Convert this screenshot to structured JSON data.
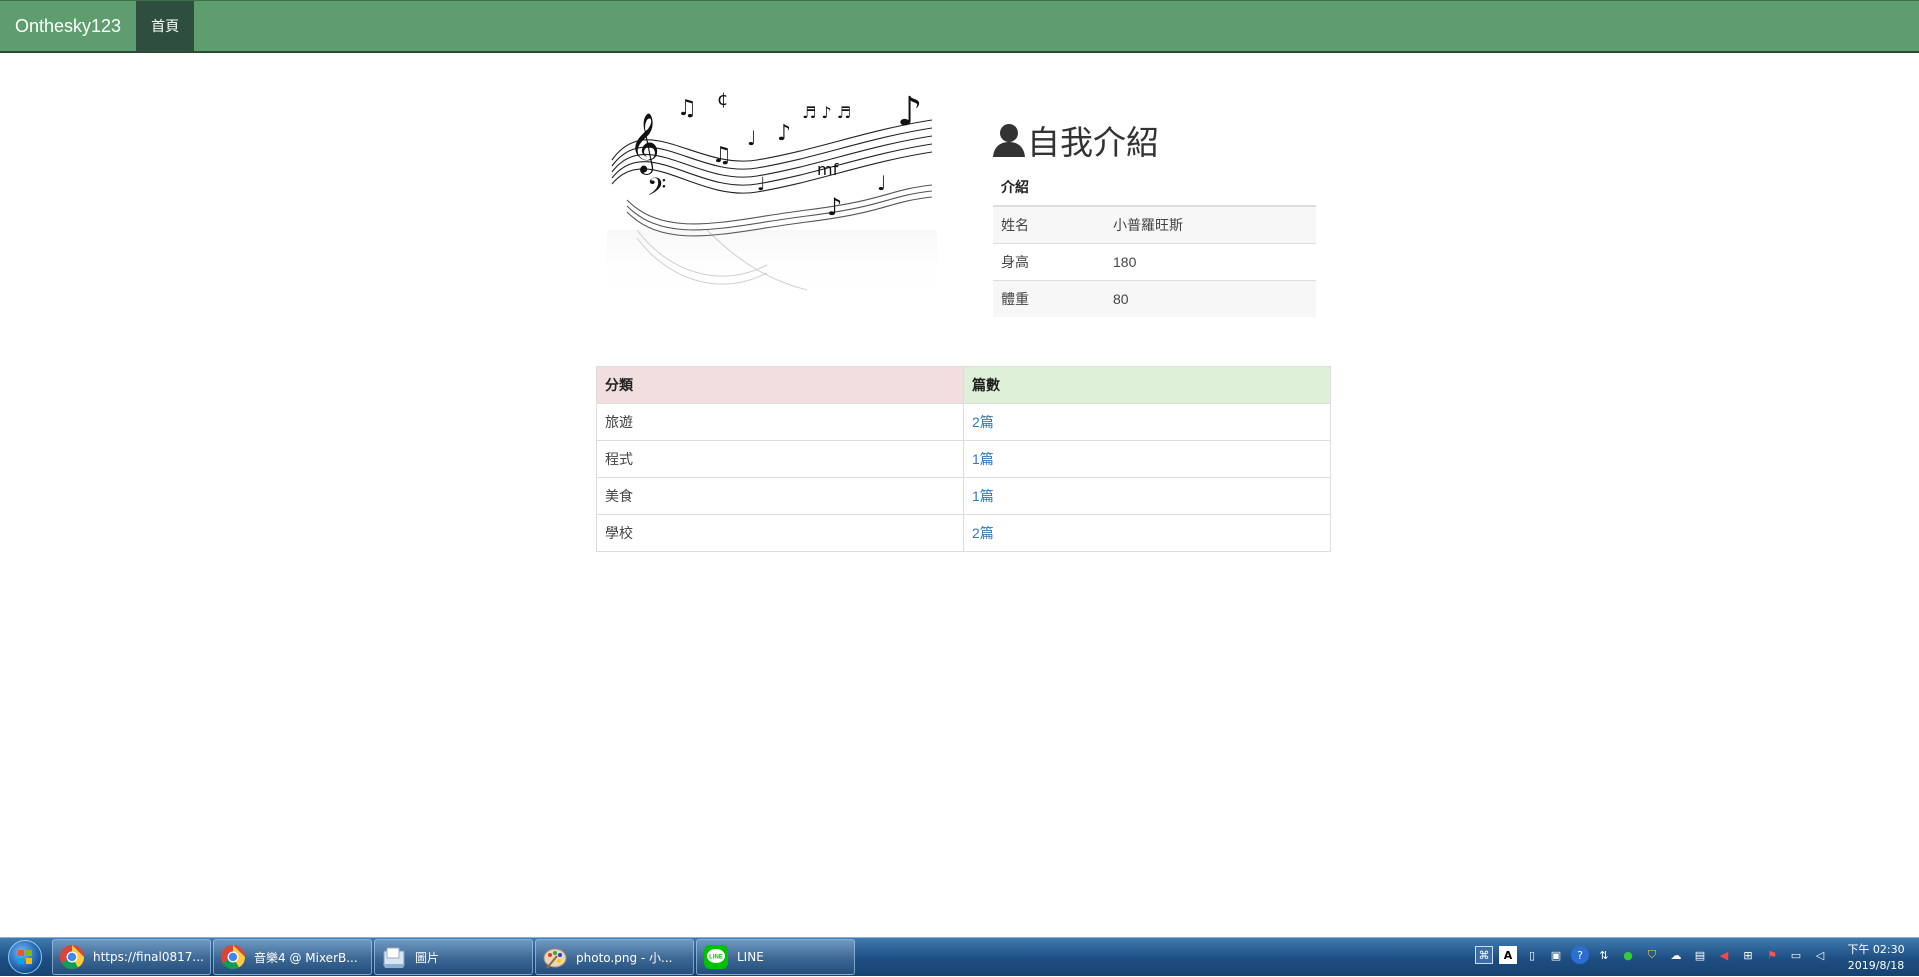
{
  "navbar": {
    "brand": "Onthesky123",
    "items": [
      {
        "label": "首頁",
        "active": true
      }
    ],
    "background": "#5e9e6e",
    "active_background": "#2e4f3d"
  },
  "profile": {
    "heading": "自我介紹",
    "heading_icon": "user-icon",
    "table_header": "介紹",
    "rows": [
      {
        "key": "姓名",
        "value": "小普羅旺斯"
      },
      {
        "key": "身高",
        "value": "180"
      },
      {
        "key": "體重",
        "value": "80"
      }
    ],
    "image": "music-staff-notes-image"
  },
  "categories": {
    "headers": [
      "分類",
      "篇數"
    ],
    "header_colors": [
      "#f2dede",
      "#dff0d8"
    ],
    "rows": [
      {
        "name": "旅遊",
        "count": "2篇"
      },
      {
        "name": "程式",
        "count": "1篇"
      },
      {
        "name": "美食",
        "count": "1篇"
      },
      {
        "name": "學校",
        "count": "2篇"
      }
    ],
    "link_color": "#337ab7"
  },
  "taskbar": {
    "tasks": [
      {
        "label": "https://final0817...",
        "icon": "chrome-icon"
      },
      {
        "label": "音樂4 @ MixerB...",
        "icon": "chrome-icon"
      },
      {
        "label": "圖片",
        "icon": "folder-icon"
      },
      {
        "label": "photo.png - 小...",
        "icon": "paint-icon"
      },
      {
        "label": "LINE",
        "icon": "line-icon"
      }
    ],
    "clock_time": "下午 02:30",
    "clock_date": "2019/8/18"
  }
}
